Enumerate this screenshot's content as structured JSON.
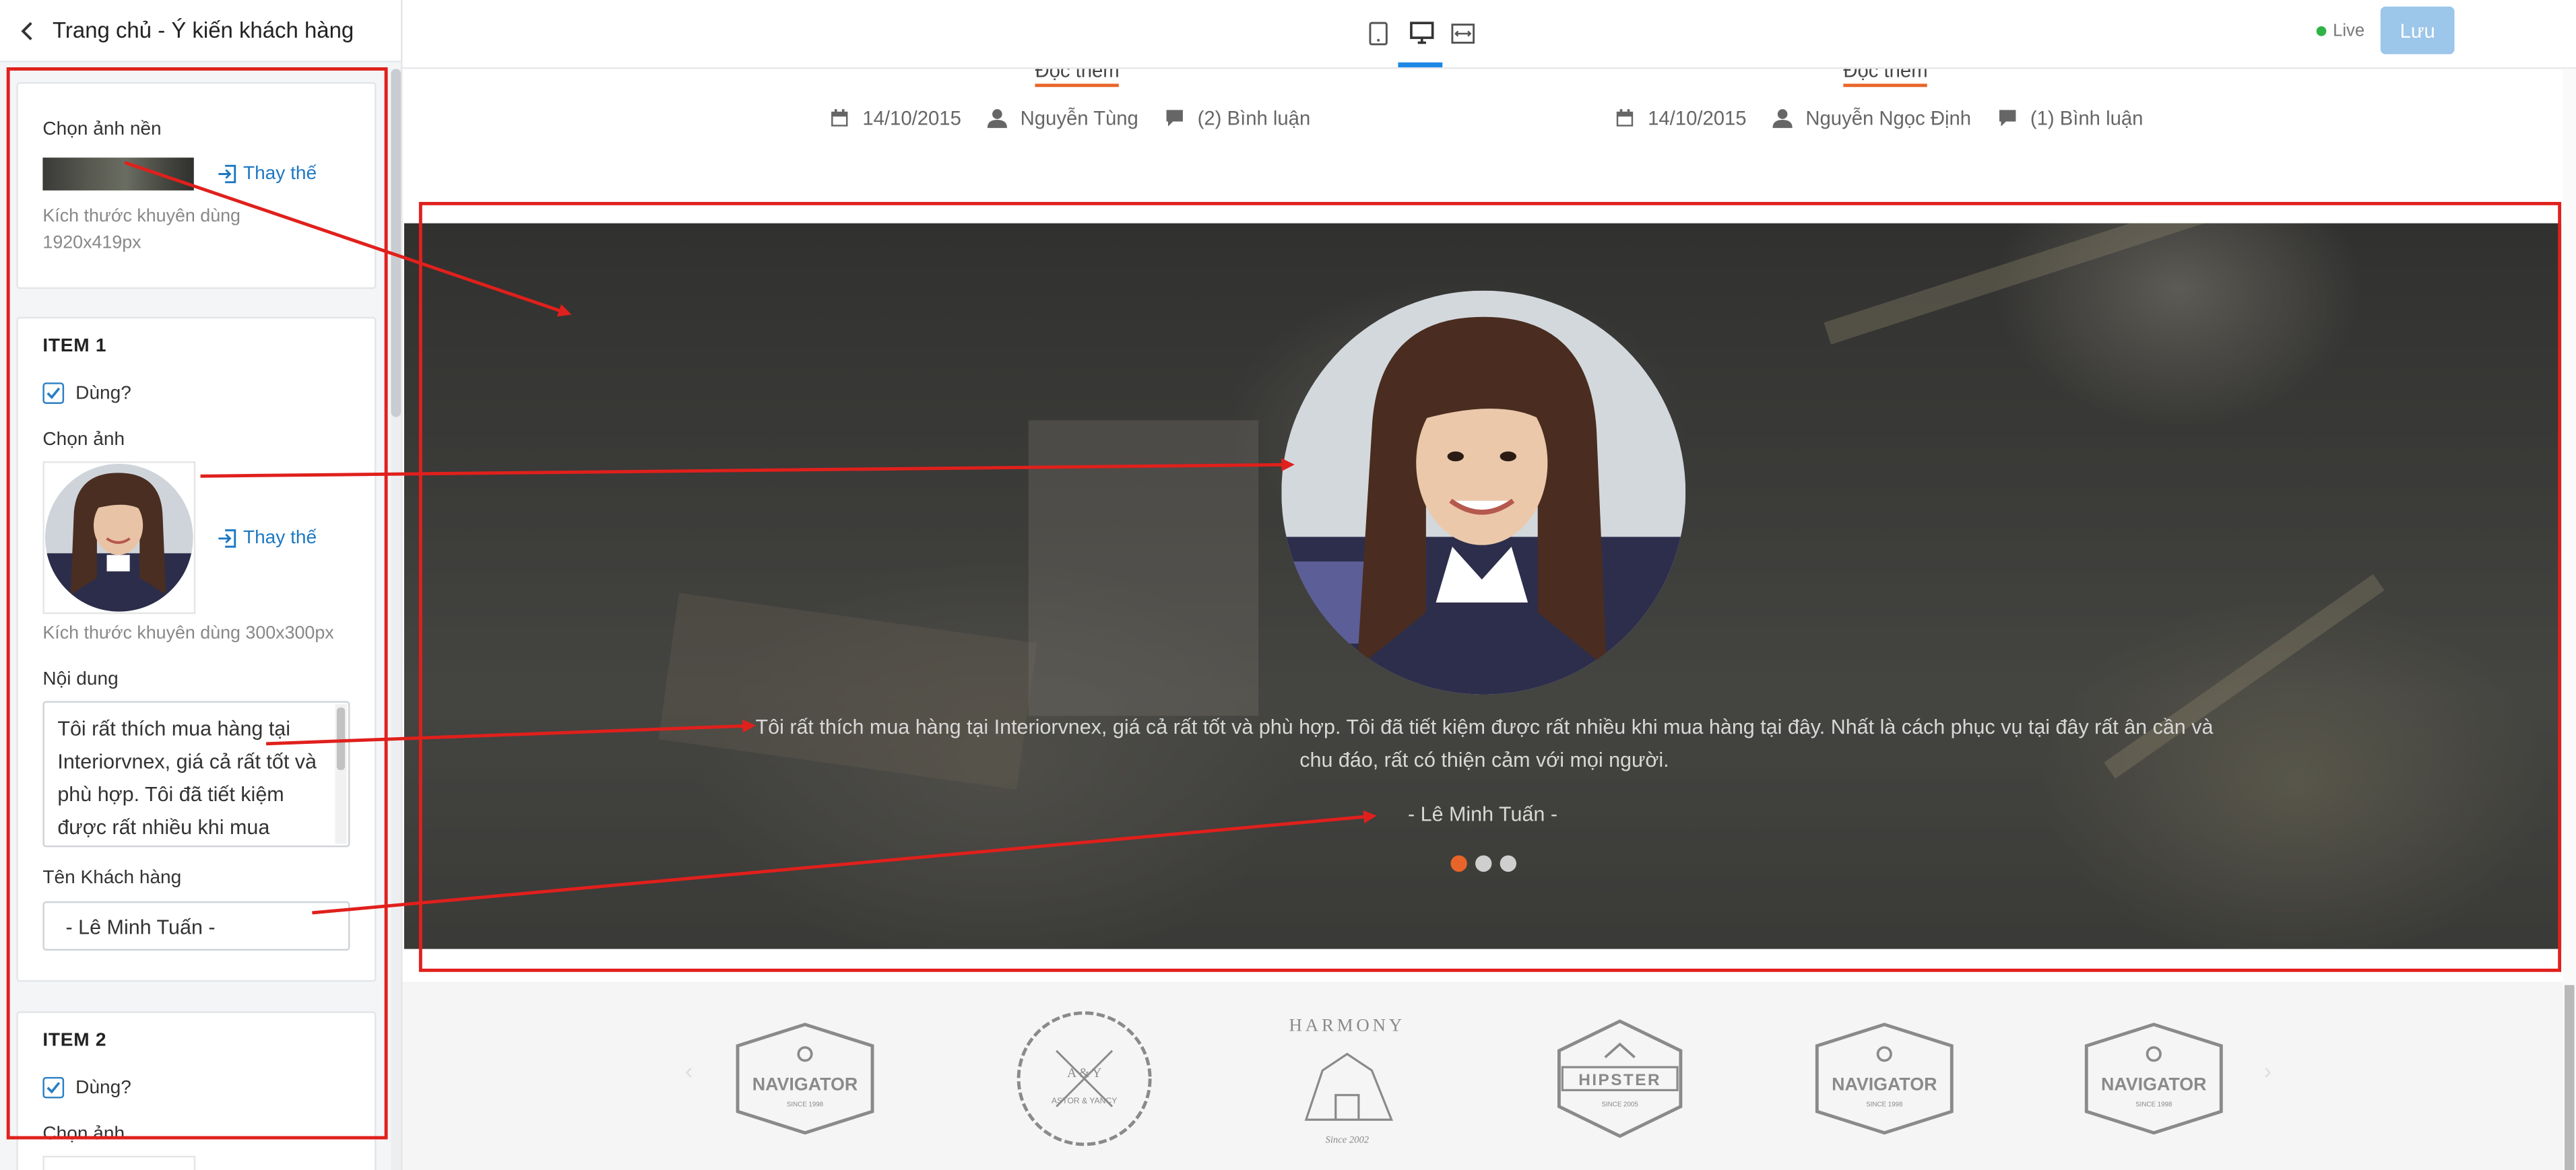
{
  "sidebar": {
    "title": "Trang chủ - Ý kiến khách hàng",
    "background": {
      "label": "Chọn ảnh nền",
      "replace": "Thay thế",
      "hint": "Kích thước khuyên dùng 1920x419px"
    },
    "item1": {
      "title": "ITEM 1",
      "use_label": "Dùng?",
      "image_label": "Chọn ảnh",
      "replace": "Thay thế",
      "image_hint": "Kích thước khuyên dùng 300x300px",
      "content_label": "Nội dung",
      "content_value": "Tôi rất thích mua hàng tại Interiorvnex, giá cả rất tốt và phù hợp. Tôi đã tiết kiệm được rất nhiều khi mua",
      "name_label": "Tên Khách hàng",
      "name_value": "- Lê Minh Tuấn -"
    },
    "item2": {
      "title": "ITEM 2",
      "use_label": "Dùng?",
      "image_label": "Chọn ảnh"
    }
  },
  "topbar": {
    "live_label": "Live",
    "save_label": "Lưu"
  },
  "preview": {
    "posts": [
      {
        "readmore": "Đọc thêm",
        "date": "14/10/2015",
        "author": "Nguyễn Tùng",
        "comments": "(2) Bình luận"
      },
      {
        "readmore": "Đọc thêm",
        "date": "14/10/2015",
        "author": "Nguyễn Ngọc Định",
        "comments": "(1) Bình luận"
      }
    ],
    "testimonial": {
      "quote": "Tôi rất thích mua hàng tại Interiorvnex, giá cả rất tốt và phù hợp. Tôi đã tiết kiệm được rất nhiều khi mua hàng tại đây. Nhất là cách phục vụ tại đây rất ân cần và chu đáo, rất có thiện cảm với mọi người.",
      "author": "- Lê Minh Tuấn -",
      "slides": 3,
      "active_slide": 1
    },
    "logos": [
      {
        "name": "navigator",
        "text": "NAVIGATOR",
        "sub": "SINCE 1998"
      },
      {
        "name": "astor-yancy",
        "text": "ASTOR & YANCY",
        "sub": "A & Y"
      },
      {
        "name": "harmony",
        "text": "HARMONY",
        "sub": "Since 2002"
      },
      {
        "name": "hipster",
        "text": "HIPSTER",
        "sub": "SINCE 2005"
      },
      {
        "name": "navigator",
        "text": "NAVIGATOR",
        "sub": "SINCE 1998"
      },
      {
        "name": "navigator",
        "text": "NAVIGATOR",
        "sub": "SINCE 1998"
      }
    ]
  },
  "colors": {
    "accent": "#1e78c2",
    "save_button": "#9cc6ea",
    "live_dot": "#2fb344",
    "slider_active": "#e8652a",
    "annotation": "#e0201c"
  }
}
